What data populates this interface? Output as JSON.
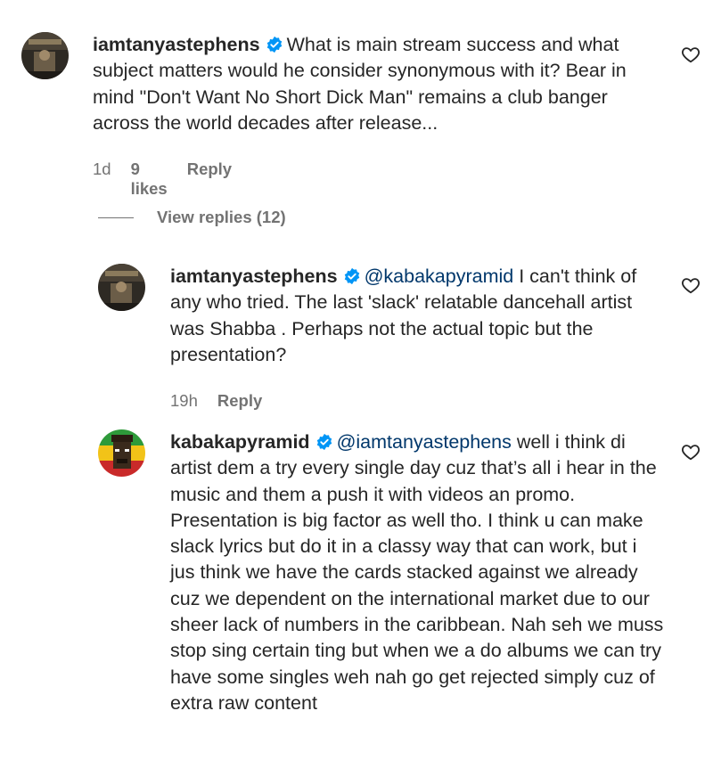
{
  "comments": [
    {
      "username": "iamtanyastephens",
      "mention": "",
      "text": "What is main stream success and what subject matters would he consider synonymous with it? Bear in mind \"Don't Want No Short Dick Man\" remains a club banger across the world decades after release...",
      "time": "1d",
      "likes": "9 likes",
      "reply": "Reply",
      "avatar_icon": "profile-photo"
    },
    {
      "username": "iamtanyastephens",
      "mention": "@kabakapyramid",
      "text": "I can't think of any who tried. The last 'slack' relatable dancehall artist was Shabba . Perhaps not the actual topic but the presentation?",
      "time": "19h",
      "likes": "",
      "reply": "Reply",
      "avatar_icon": "profile-photo"
    },
    {
      "username": "kabakapyramid",
      "mention": "@iamtanyastephens",
      "text": "well i think di artist dem a try every single day cuz that’s all i hear in the music and them a push it with videos an promo. Presentation is big factor as well tho. I think u can make slack lyrics but do it in a classy way that can work, but i jus think we have the cards stacked against we already cuz we dependent on the international market due to our sheer lack of numbers in the caribbean. Nah seh we muss stop sing certain ting but when we a do albums we can try have some singles weh nah go get rejected simply cuz of extra raw content",
      "time": "",
      "likes": "",
      "reply": "",
      "avatar_icon": "pixel-art-profile"
    }
  ],
  "view_replies": "View replies (12)",
  "colors": {
    "verified": "#0095f6",
    "mention": "#00376b",
    "meta": "#737373",
    "text": "#262626"
  }
}
